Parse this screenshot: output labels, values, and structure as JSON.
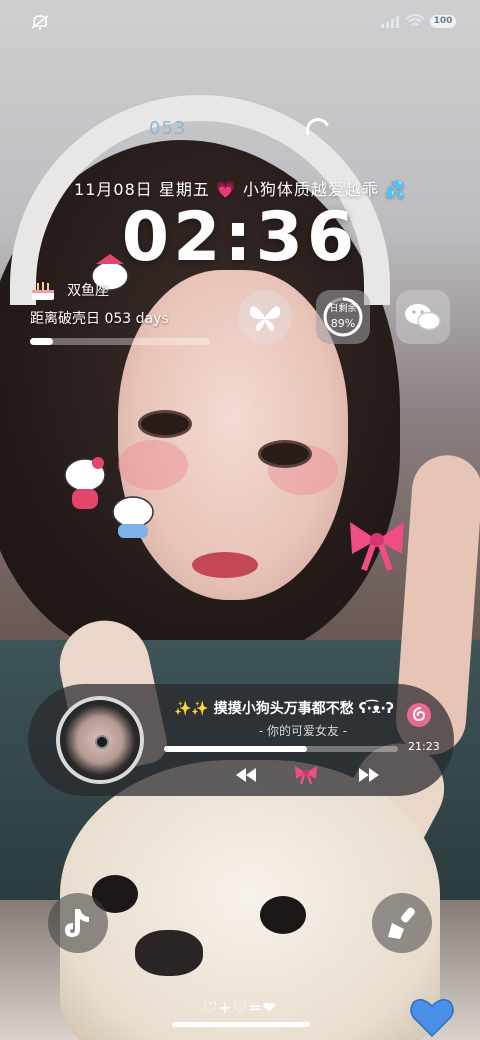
{
  "status_bar": {
    "left_icon": "mute-icon",
    "right_icons": [
      "signal-icon",
      "wifi-icon"
    ],
    "battery": "100"
  },
  "counter": "053",
  "date_line": "11月08日  星期五  💗 小狗体质越爱越乖 💦",
  "time": "02:36",
  "birthday_widget": {
    "icon": "cake-icon",
    "label": "双鱼座",
    "countdown": "距离破壳日 053 days",
    "progress": 0.13
  },
  "shortcuts": {
    "butterfly": "butterfly-icon",
    "wechat": "wechat-icon",
    "day_remaining_label": "日剩余",
    "day_remaining_pct": "89%",
    "day_remaining_value": 0.89
  },
  "music": {
    "song": "✨✨ 摸摸小狗头万事都不愁 ʕ·͡ᴥ·ʔ",
    "artist": "- 你的可爱女友 -",
    "duration": "21:23",
    "progress": 0.61,
    "app_icon": "netease-music-icon"
  },
  "dock": {
    "left": "tiktok-icon",
    "right": "brush-icon"
  },
  "footer": "♡+♡=❤"
}
